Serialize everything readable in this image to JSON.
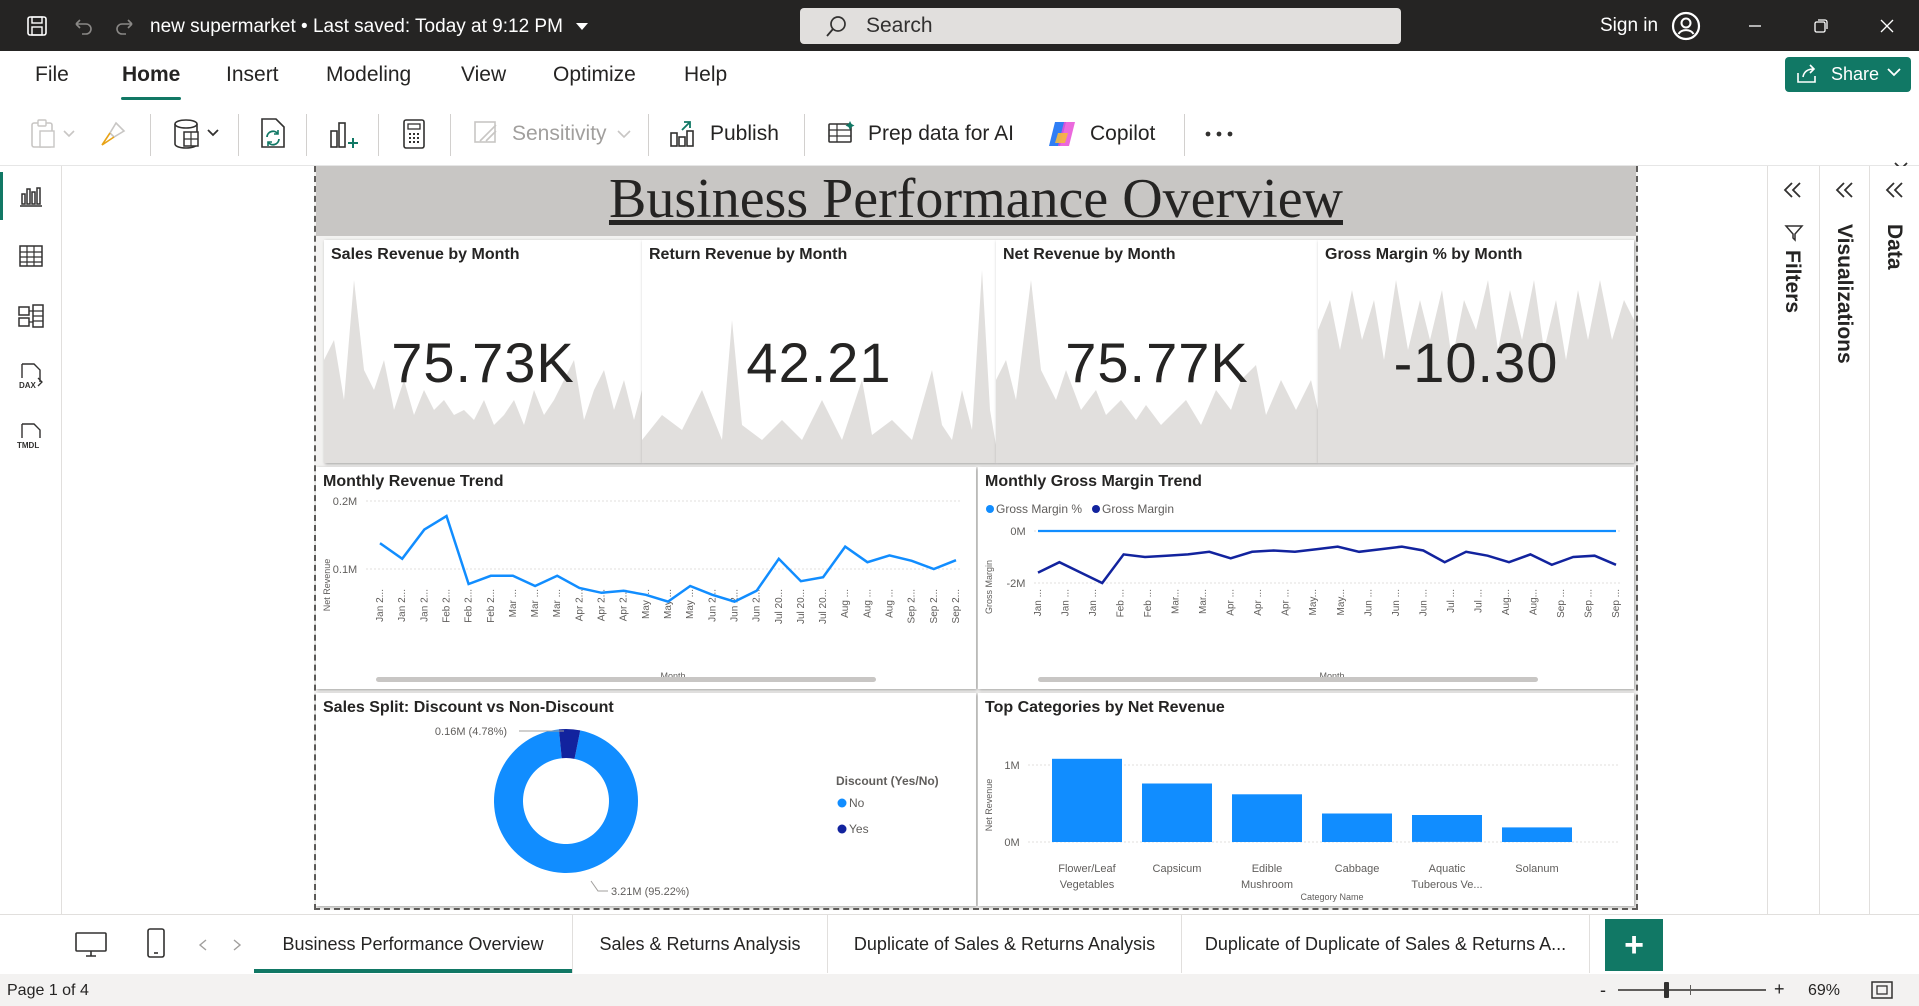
{
  "titlebar": {
    "doc_title": "new supermarket",
    "save_status": "Last saved: Today at 9:12 PM",
    "search_placeholder": "Search",
    "sign_in": "Sign in"
  },
  "ribbon": {
    "tabs": [
      "File",
      "Home",
      "Insert",
      "Modeling",
      "View",
      "Optimize",
      "Help"
    ],
    "active_tab": "Home",
    "share_label": "Share",
    "tools": {
      "sensitivity": "Sensitivity",
      "publish": "Publish",
      "prep_data": "Prep data for AI",
      "copilot": "Copilot"
    }
  },
  "report": {
    "title": "Business Performance Overview",
    "kpis": [
      {
        "title": "Sales Revenue by Month",
        "value": "75.73K"
      },
      {
        "title": "Return Revenue by Month",
        "value": "42.21"
      },
      {
        "title": "Net Revenue by Month",
        "value": "75.77K"
      },
      {
        "title": "Gross Margin % by Month",
        "value": "-10.30"
      }
    ],
    "revenue_trend": {
      "title": "Monthly Revenue Trend",
      "ylabel": "Net Revenue",
      "xlabel": "Month",
      "ticks": [
        "0.2M",
        "0.1M"
      ]
    },
    "margin_trend": {
      "title": "Monthly Gross Margin Trend",
      "legend": [
        "Gross Margin %",
        "Gross Margin"
      ],
      "ylabel": "Gross Margin",
      "xlabel": "Month",
      "ticks": [
        "0M",
        "-2M"
      ]
    },
    "discount_split": {
      "title": "Sales Split: Discount vs Non-Discount",
      "legend_title": "Discount (Yes/No)",
      "legend": [
        "No",
        "Yes"
      ],
      "label_yes": "0.16M (4.78%)",
      "label_no": "3.21M (95.22%)"
    },
    "top_categories": {
      "title": "Top Categories by Net Revenue",
      "ylabel": "Net Revenue",
      "xlabel": "Category Name",
      "ticks": [
        "1M",
        "0M"
      ],
      "categories": [
        [
          "Flower/Leaf",
          "Vegetables"
        ],
        [
          "Capsicum"
        ],
        [
          "Edible",
          "Mushroom"
        ],
        [
          "Cabbage"
        ],
        [
          "Aquatic",
          "Tuberous Ve..."
        ],
        [
          "Solanum"
        ]
      ]
    }
  },
  "panes": {
    "filters": "Filters",
    "visualizations": "Visualizations",
    "data": "Data"
  },
  "pages": [
    "Business Performance Overview",
    "Sales & Returns Analysis",
    "Duplicate of Sales & Returns Analysis",
    "Duplicate of Duplicate of Sales & Returns A..."
  ],
  "status": {
    "page": "Page 1 of 4",
    "zoom": "69%"
  },
  "colors": {
    "accent": "#117865",
    "series_light": "#118dff",
    "series_dark": "#12239e",
    "spark": "#e1dfdd"
  },
  "chart_data": [
    {
      "type": "line",
      "title": "Monthly Revenue Trend",
      "xlabel": "Month",
      "ylabel": "Net Revenue",
      "ylim": [
        0,
        0.2
      ],
      "series": [
        {
          "values": [
            0.138,
            0.115,
            0.158,
            0.178,
            0.078,
            0.09,
            0.09,
            0.075,
            0.09,
            0.072,
            0.065,
            0.068,
            0.062,
            0.052,
            0.075,
            0.062,
            0.052,
            0.068,
            0.115,
            0.082,
            0.088,
            0.133,
            0.11,
            0.12,
            0.112,
            0.1,
            0.113
          ]
        }
      ],
      "x": [
        "Jan 2...",
        "Jan 2...",
        "Jan 2...",
        "Feb 2...",
        "Feb 2...",
        "Feb 2...",
        "Mar ...",
        "Mar ...",
        "Mar ...",
        "Apr 2...",
        "Apr 2...",
        "Apr 2...",
        "May ...",
        "May ...",
        "May ...",
        "Jun 2...",
        "Jun 2...",
        "Jun 2...",
        "Jul 20...",
        "Jul 20...",
        "Jul 20...",
        "Aug ...",
        "Aug ...",
        "Aug ...",
        "Sep 2...",
        "Sep 2...",
        "Sep 2..."
      ]
    },
    {
      "type": "line",
      "title": "Monthly Gross Margin Trend",
      "xlabel": "Month",
      "ylabel": "Gross Margin",
      "series": [
        {
          "name": "Gross Margin %",
          "values": [
            0,
            0,
            0,
            0,
            0,
            0,
            0,
            0,
            0,
            0,
            0,
            0,
            0,
            0,
            0,
            0,
            0,
            0,
            0,
            0,
            0,
            0,
            0,
            0,
            0,
            0,
            0
          ]
        },
        {
          "name": "Gross Margin",
          "values": [
            -1.6,
            -1.2,
            -1.6,
            -2.0,
            -0.9,
            -1.0,
            -0.95,
            -0.9,
            -0.8,
            -1.05,
            -0.8,
            -0.75,
            -0.8,
            -0.7,
            -0.6,
            -0.8,
            -0.7,
            -0.6,
            -0.75,
            -1.2,
            -0.8,
            -0.95,
            -1.2,
            -0.9,
            -1.3,
            -1.0,
            -0.95,
            -1.3
          ]
        }
      ],
      "x": [
        "Jan ...",
        "Jan ...",
        "Jan ...",
        "Feb ...",
        "Feb ...",
        "Mar...",
        "Mar...",
        "Apr ...",
        "Apr ...",
        "Apr ...",
        "May...",
        "May...",
        "Jun ...",
        "Jun ...",
        "Jun ...",
        "Jul ...",
        "Jul ...",
        "Aug...",
        "Aug...",
        "Sep ...",
        "Sep ...",
        "Sep ..."
      ]
    },
    {
      "type": "pie",
      "title": "Sales Split: Discount vs Non-Discount",
      "categories": [
        "No",
        "Yes"
      ],
      "values": [
        3.21,
        0.16
      ],
      "labels": [
        "3.21M (95.22%)",
        "0.16M (4.78%)"
      ]
    },
    {
      "type": "bar",
      "title": "Top Categories by Net Revenue",
      "xlabel": "Category Name",
      "ylabel": "Net Revenue",
      "categories": [
        "Flower/Leaf Vegetables",
        "Capsicum",
        "Edible Mushroom",
        "Cabbage",
        "Aquatic Tuberous Ve...",
        "Solanum"
      ],
      "values": [
        1.08,
        0.76,
        0.62,
        0.37,
        0.35,
        0.19
      ],
      "ylim": [
        0,
        1.2
      ]
    }
  ]
}
